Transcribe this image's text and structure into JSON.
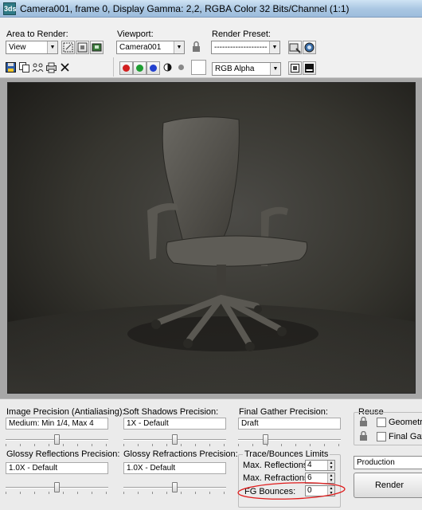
{
  "window": {
    "title": "Camera001, frame 0, Display Gamma: 2,2, RGBA Color 32 Bits/Channel (1:1)",
    "icon_text": "3ds"
  },
  "toolbar": {
    "area_label": "Area to Render:",
    "area_value": "View",
    "viewport_label": "Viewport:",
    "viewport_value": "Camera001",
    "preset_label": "Render Preset:",
    "preset_value": "--------------------",
    "channel_value": "RGB Alpha",
    "icons": [
      "save-icon",
      "copy-icon",
      "clone-icon",
      "print-icon",
      "clear-icon",
      "red-channel-icon",
      "green-channel-icon",
      "blue-channel-icon",
      "mono-icon",
      "alpha-icon",
      "color-swatch-icon",
      "display-channel-icon",
      "frame-toggle-icon"
    ],
    "colors": {
      "red": "#d21f1f",
      "green": "#1e9e32",
      "blue": "#2341cf"
    }
  },
  "settings": {
    "image_precision_label": "Image Precision (Antialiasing):",
    "image_precision_value": "Medium: Min 1/4, Max 4",
    "image_precision_slider": 0.5,
    "soft_shadows_label": "Soft Shadows Precision:",
    "soft_shadows_value": "1X - Default",
    "soft_shadows_slider": 0.5,
    "final_gather_label": "Final Gather Precision:",
    "final_gather_value": "Draft",
    "final_gather_slider": 0.25,
    "glossy_reflections_label": "Glossy Reflections Precision:",
    "glossy_reflections_value": "1.0X - Default",
    "glossy_reflections_slider": 0.5,
    "glossy_refractions_label": "Glossy Refractions Precision:",
    "glossy_refractions_value": "1.0X - Default",
    "glossy_refractions_slider": 0.5,
    "trace_group_label": "Trace/Bounces Limits",
    "max_reflections_label": "Max. Reflections:",
    "max_reflections_value": "4",
    "max_refractions_label": "Max. Refractions:",
    "max_refractions_value": "6",
    "fg_bounces_label": "FG Bounces:",
    "fg_bounces_value": "0",
    "reuse_label": "Reuse",
    "geometry_label": "Geometry",
    "final_gather_reuse_label": "Final Gather",
    "production_value": "Production",
    "render_label": "Render",
    "highlight_color": "#e01a1a"
  }
}
